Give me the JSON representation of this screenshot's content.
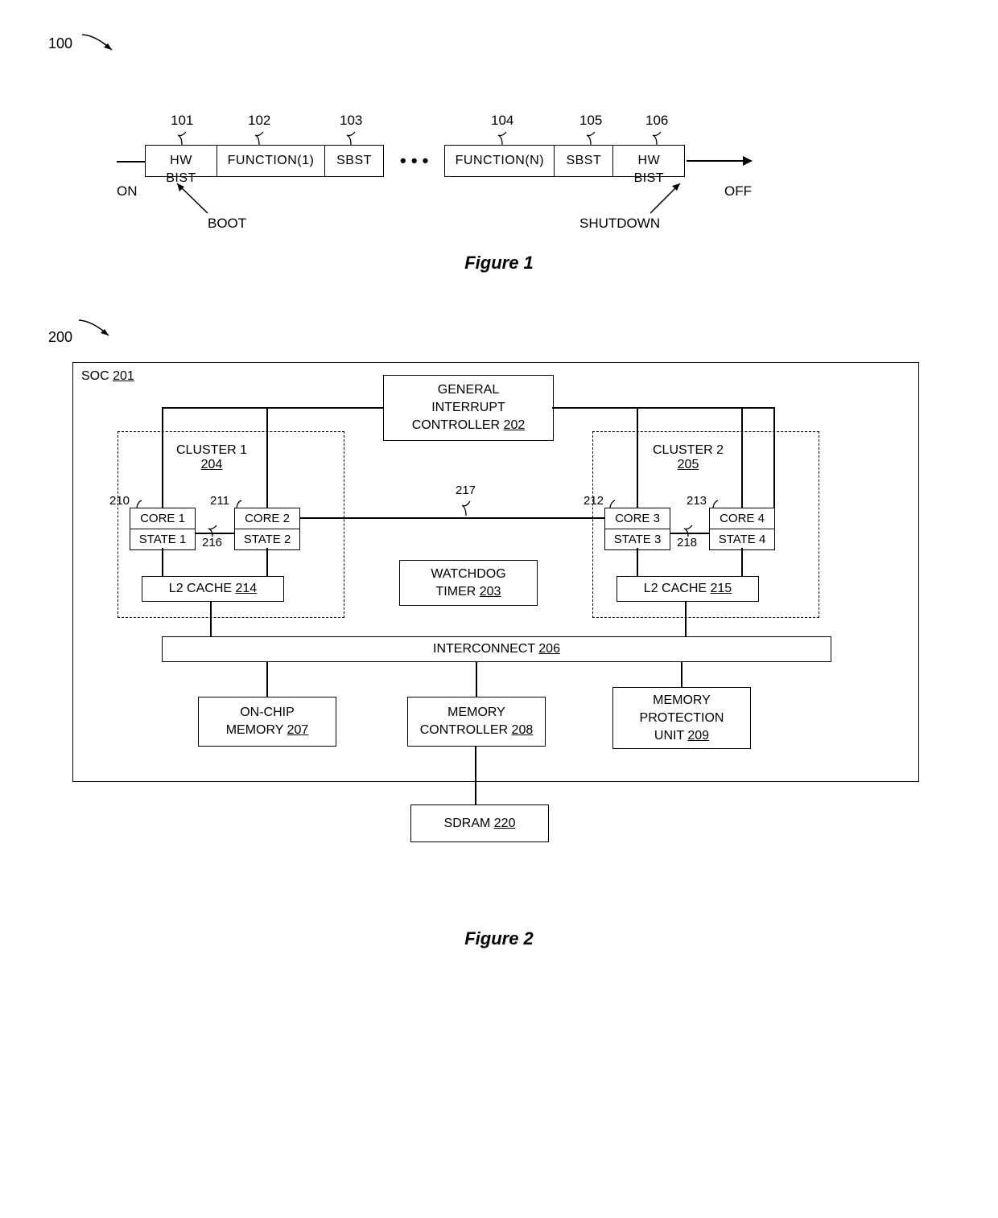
{
  "fig1": {
    "ref": "100",
    "boxes": {
      "b101": "HW BIST",
      "b102": "FUNCTION(1)",
      "b103": "SBST",
      "b104": "FUNCTION(N)",
      "b105": "SBST",
      "b106": "HW BIST"
    },
    "nums": {
      "n101": "101",
      "n102": "102",
      "n103": "103",
      "n104": "104",
      "n105": "105",
      "n106": "106"
    },
    "ellipsis": "•  •  •",
    "on": "ON",
    "off": "OFF",
    "boot": "BOOT",
    "shutdown": "SHUTDOWN",
    "caption": "Figure 1"
  },
  "fig2": {
    "ref": "200",
    "soc_label": "SOC ",
    "soc_num": "201",
    "gic": "GENERAL\nINTERRUPT\nCONTROLLER ",
    "gic_num": "202",
    "watchdog": "WATCHDOG\nTIMER ",
    "watchdog_num": "203",
    "interconnect": "INTERCONNECT ",
    "interconnect_num": "206",
    "onchip": "ON-CHIP\nMEMORY ",
    "onchip_num": "207",
    "memctrl": "MEMORY\nCONTROLLER ",
    "memctrl_num": "208",
    "mpu": "MEMORY\nPROTECTION\nUNIT ",
    "mpu_num": "209",
    "sdram": "SDRAM ",
    "sdram_num": "220",
    "cluster1": "CLUSTER 1",
    "cluster1_num": "204",
    "cluster2": "CLUSTER 2",
    "cluster2_num": "205",
    "n210": "210",
    "n211": "211",
    "n212": "212",
    "n213": "213",
    "n216": "216",
    "n217": "217",
    "n218": "218",
    "core1": "CORE 1",
    "state1": "STATE 1",
    "core2": "CORE 2",
    "state2": "STATE 2",
    "core3": "CORE 3",
    "state3": "STATE 3",
    "core4": "CORE 4",
    "state4": "STATE 4",
    "l2_1": "L2 CACHE ",
    "l2_1_num": "214",
    "l2_2": "L2 CACHE ",
    "l2_2_num": "215",
    "caption": "Figure 2"
  }
}
